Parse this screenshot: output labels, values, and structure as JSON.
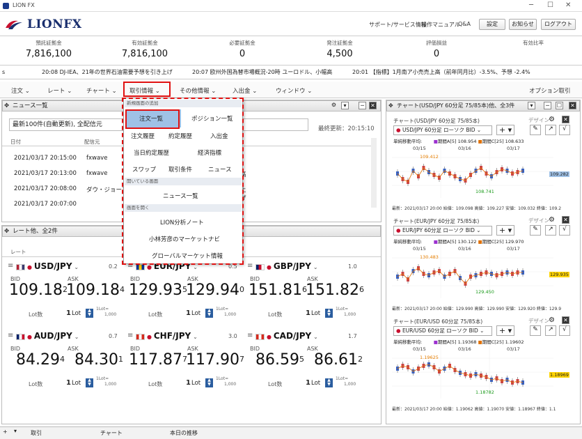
{
  "window": {
    "title": "LION FX"
  },
  "brand": {
    "name": "LIONFX"
  },
  "header_links": [
    "サポート/サービス情報",
    "操作マニュアル",
    "Q&A"
  ],
  "header_buttons": [
    "設定",
    "お知らせ",
    "ログアウト"
  ],
  "account": [
    {
      "label": "預託証拠金",
      "value": "7,816,100"
    },
    {
      "label": "有効証拠金",
      "value": "7,816,100"
    },
    {
      "label": "必要証拠金",
      "value": "0"
    },
    {
      "label": "発注証拠金",
      "value": "4,500"
    },
    {
      "label": "評価損益",
      "value": "0"
    },
    {
      "label": "有効比率",
      "value": ""
    }
  ],
  "ticker": [
    "20:08 DJ-IEA、21年の世界石油需要予想を引き上げ",
    "20:07 欧州外国為替市場概況-20時 ユーロドル、小幅高",
    "20:01 【指標】1月南ア小売売上高（前年同月比）-3.5%、予想 -2.4%"
  ],
  "menu": {
    "items": [
      "注文",
      "レート",
      "チャート",
      "取引情報",
      "その他情報",
      "入出金",
      "ウィンドウ"
    ],
    "right": "オプション取引"
  },
  "news": {
    "title": "ニュース一覧",
    "filter": "最新100件(自動更新), 全配信元",
    "updated": "最終更新：20:15:10",
    "cols": [
      "日付",
      "配信元"
    ],
    "rows": [
      {
        "date": "2021/03/17 20:15:00",
        "source": "fxwave",
        "tail": ""
      },
      {
        "date": "2021/03/17 20:13:00",
        "source": "fxwave",
        "tail": "高"
      },
      {
        "date": "2021/03/17 20:08:00",
        "source": "ダウ・ジョーンズ",
        "tail": "上げ"
      },
      {
        "date": "2021/03/17 20:07:00",
        "source": "fxwave",
        "tail": "概況"
      }
    ]
  },
  "rates": {
    "title": "レート他、全2件",
    "col": "レート",
    "cards": [
      {
        "pair": "USD/JPY",
        "spread": "0.2",
        "bid_main": "109.18",
        "bid_sup": "2",
        "ask_main": "109.18",
        "ask_sup": "4",
        "lot": "1"
      },
      {
        "pair": "EUR/JPY",
        "spread": "0.5",
        "bid_main": "129.93",
        "bid_sup": "5",
        "ask_main": "129.94",
        "ask_sup": "0",
        "lot": "1"
      },
      {
        "pair": "GBP/JPY",
        "spread": "1.0",
        "bid_main": "151.81",
        "bid_sup": "6",
        "ask_main": "151.82",
        "ask_sup": "6",
        "lot": "1"
      },
      {
        "pair": "AUD/JPY",
        "spread": "0.7",
        "bid_main": "84.29",
        "bid_sup": "4",
        "ask_main": "84.30",
        "ask_sup": "1",
        "lot": "1"
      },
      {
        "pair": "CHF/JPY",
        "spread": "3.0",
        "bid_main": "117.87",
        "bid_sup": "7",
        "ask_main": "117.90",
        "ask_sup": "7",
        "lot": "1"
      },
      {
        "pair": "CAD/JPY",
        "spread": "1.7",
        "bid_main": "86.59",
        "bid_sup": "5",
        "ask_main": "86.61",
        "ask_sup": "2",
        "lot": "1"
      }
    ],
    "bid_label": "BID",
    "ask_label": "ASK",
    "lot_label": "Lot数",
    "lot_unit": "Lot",
    "lot_note1": "1Lot=",
    "lot_note2": "1,000"
  },
  "dropdown": {
    "sec1": "新規画面の追加",
    "items1": [
      "注文一覧",
      "ポジション一覧",
      "注文履歴",
      "約定履歴",
      "入出金",
      "当日約定履歴",
      "経済指標",
      "スワップ",
      "取引条件",
      "ニュース"
    ],
    "sec2": "開いている画面",
    "items2": [
      "ニュース一覧"
    ],
    "sec3": "画面を開く",
    "items3": [
      "LION分析ノート",
      "小林芳彦のマーケットナビ",
      "グローバルマーケット情報"
    ]
  },
  "charts_panel": {
    "title": "チャート(USD/JPY 60分足 75/85本)他、全3件",
    "design": "デザイン",
    "charts": [
      {
        "title": "チャート(USD/JPY 60分足 75/85本)",
        "sym": "USD/JPY 60分足 ローソク BID",
        "ind": "単純移動平均:",
        "ma5": "期間A[5] 108.954",
        "ma25": "期間C[25] 108.633",
        "hi": "109.412",
        "lo": "108.741",
        "last": "109.282",
        "axis": [
          "03/15",
          "03/16",
          "03/17"
        ],
        "foot": "最新：2021/03/17 20:00 始値：109.098 高値：109.227 安値：109.032 終値：109.2"
      },
      {
        "title": "チャート(EUR/JPY 60分足 75/85本)",
        "sym": "EUR/JPY 60分足 ローソク BID",
        "ind": "単純移動平均:",
        "ma5": "期間A[5] 130.122",
        "ma25": "期間C[25] 129.970",
        "hi": "130.483",
        "lo": "129.450",
        "last": "129.935",
        "axis": [
          "03/15",
          "03/16",
          "03/17"
        ],
        "foot": "最新：2021/03/17 20:00 始値：129.990 高値：129.990 安値：129.920 終値：129.9"
      },
      {
        "title": "チャート(EUR/USD 60分足 75/85本)",
        "sym": "EUR/USD 60分足 ローソク BID",
        "ind": "単純移動平均:",
        "ma5": "期間A[5] 1.19368",
        "ma25": "期間C[25] 1.19602",
        "hi": "1.19625",
        "lo": "1.18782",
        "last": "1.18969",
        "axis": [
          "03/15",
          "03/16",
          "03/17"
        ],
        "foot": "最新：2021/03/17 20:00 始値：1.19062 高値：1.19070 安値：1.18967 終値：1.1"
      }
    ]
  },
  "footer": {
    "tabs": [
      "取引",
      "チャート",
      "本日の推移"
    ]
  },
  "colors": {
    "accent": "#1a2f6e",
    "highlight_red": "#e01010",
    "selected_bg": "#9fc1e6",
    "price_up": "#e67e00",
    "price_down": "#1a9a1a"
  }
}
